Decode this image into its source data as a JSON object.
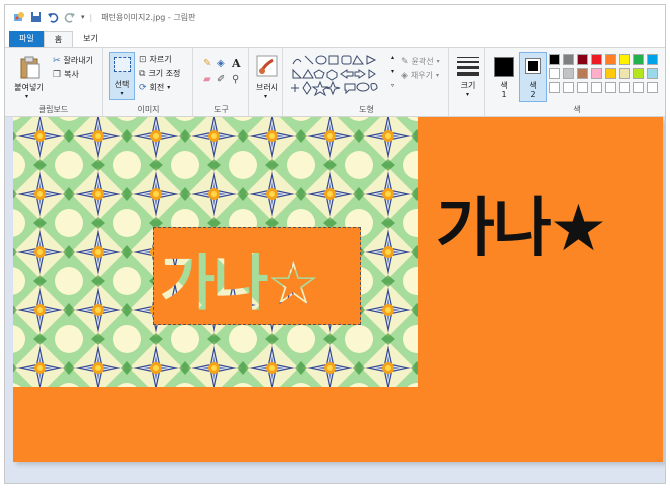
{
  "titlebar": {
    "title": "패턴용이미지2.jpg - 그림판"
  },
  "tabs": [
    {
      "label": "파일"
    },
    {
      "label": "홈"
    },
    {
      "label": "보기"
    }
  ],
  "clipboard": {
    "paste_label": "붙여넣기",
    "cut_label": "잘라내기",
    "copy_label": "복사",
    "group_label": "클립보드"
  },
  "image": {
    "select_label": "선택",
    "crop_label": "자르기",
    "resize_label": "크기 조정",
    "rotate_label": "회전",
    "group_label": "이미지"
  },
  "tools": {
    "group_label": "도구"
  },
  "brushes": {
    "label": "브러시"
  },
  "shapes": {
    "outline_label": "윤곽선",
    "fill_label": "채우기",
    "group_label": "도형"
  },
  "size": {
    "label": "크기"
  },
  "colors": {
    "color1_label": "색\n1",
    "color2_label": "색\n2",
    "group_label": "색",
    "color1": "#000000",
    "color2": "#000000",
    "palette_row1": [
      "#000000",
      "#7f7f7f",
      "#880015",
      "#ed1c24",
      "#ff7f27",
      "#fff200",
      "#22b14c",
      "#00a2e8"
    ],
    "palette_row2": [
      "#ffffff",
      "#c3c3c3",
      "#b97a57",
      "#ffaec9",
      "#ffc90e",
      "#efe4b0",
      "#b5e61d",
      "#99d9ea"
    ]
  },
  "canvas": {
    "background": "#fc8624",
    "big_text": "가나★",
    "selection_text": "가나☆"
  }
}
